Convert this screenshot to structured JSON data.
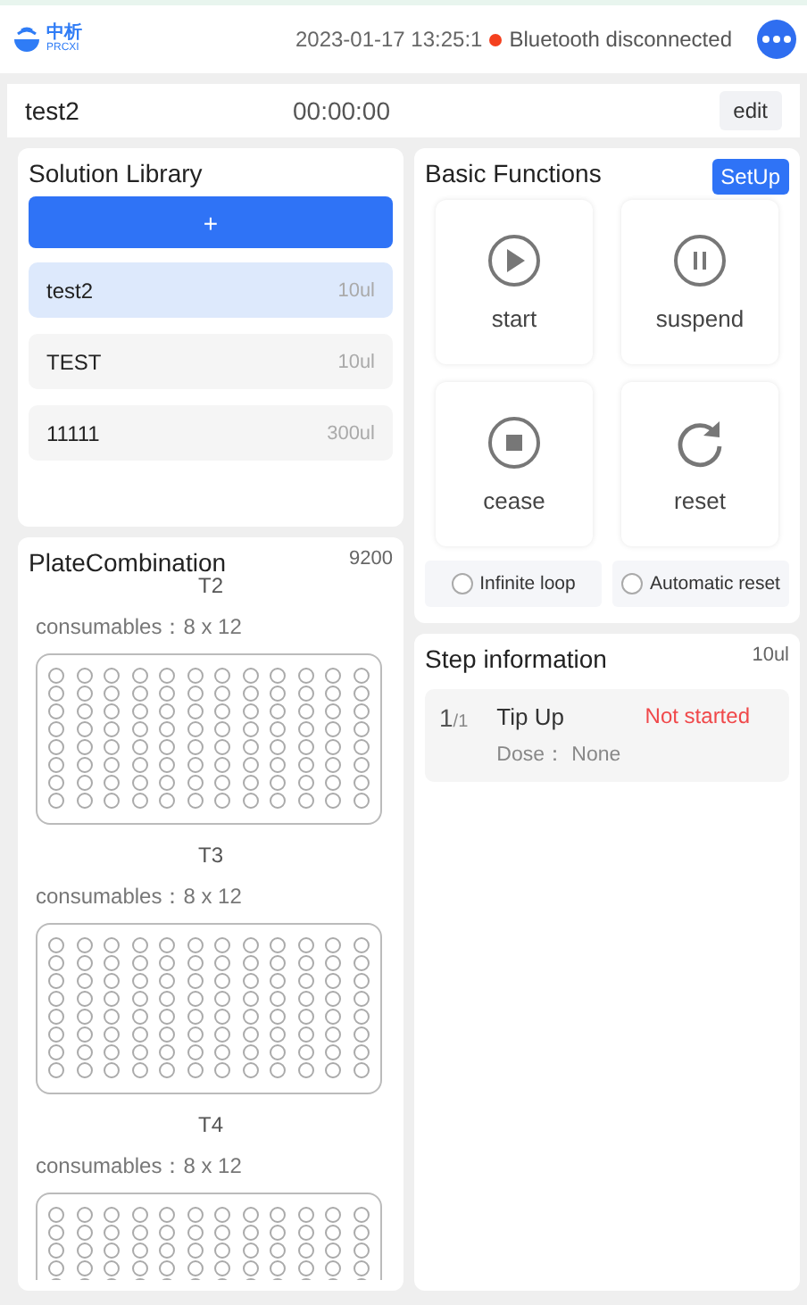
{
  "header": {
    "logo_cn": "中析",
    "logo_en": "PRCXI",
    "datetime": "2023-01-17 13:25:1",
    "bluetooth": "Bluetooth disconnected"
  },
  "run_bar": {
    "name": "test2",
    "timer": "00:00:00",
    "edit": "edit"
  },
  "solution_library": {
    "title": "Solution Library",
    "add": "+",
    "items": [
      {
        "name": "test2",
        "volume": "10ul",
        "selected": true
      },
      {
        "name": "TEST",
        "volume": "10ul",
        "selected": false
      },
      {
        "name": "11111",
        "volume": "300ul",
        "selected": false
      }
    ]
  },
  "plate_combination": {
    "title": "PlateCombination",
    "code": "9200",
    "plates": [
      {
        "label": "T2",
        "consumables": "consumables：8 x 12"
      },
      {
        "label": "T3",
        "consumables": "consumables：8 x 12"
      },
      {
        "label": "T4",
        "consumables": "consumables：8 x 12"
      }
    ]
  },
  "basic_functions": {
    "title": "Basic Functions",
    "setup": "SetUp",
    "actions": [
      {
        "kind": "play",
        "label": "start"
      },
      {
        "kind": "pause",
        "label": "suspend"
      },
      {
        "kind": "stop",
        "label": "cease"
      },
      {
        "kind": "reset",
        "label": "reset"
      }
    ],
    "options": [
      {
        "label": "Infinite loop",
        "checked": false
      },
      {
        "label": "Automatic reset",
        "checked": false
      }
    ]
  },
  "step_information": {
    "title": "Step information",
    "volume": "10ul",
    "steps": [
      {
        "index": "1",
        "total": "/1",
        "name": "Tip Up",
        "status": "Not started",
        "dose": "Dose：  None"
      }
    ]
  }
}
